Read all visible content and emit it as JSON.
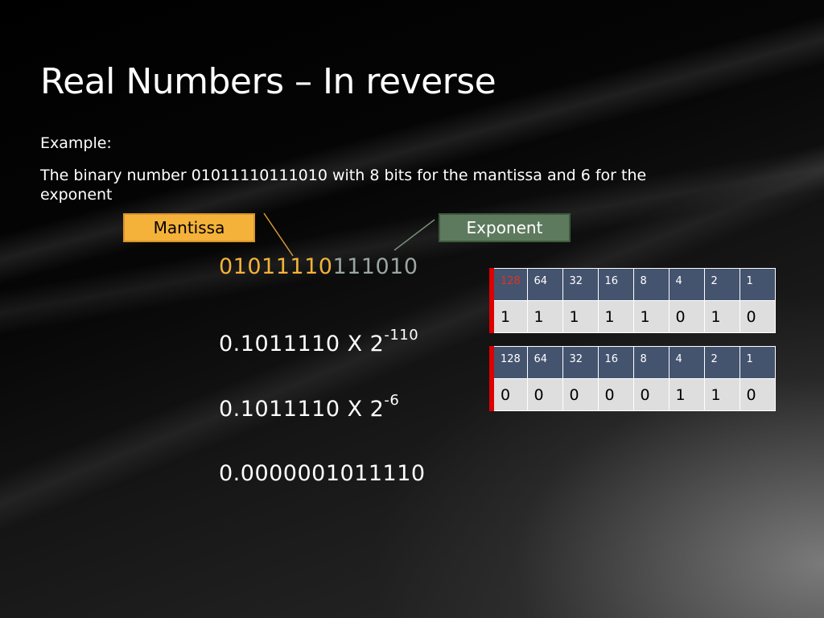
{
  "slide": {
    "title": "Real Numbers – In reverse",
    "example_label": "Example:",
    "description": "The binary number 01011110111010 with 8 bits for the mantissa and 6 for the exponent"
  },
  "labels": {
    "mantissa": "Mantissa",
    "exponent": "Exponent"
  },
  "binary": {
    "mantissa_bits": "01011110",
    "exponent_bits": "111010"
  },
  "steps": [
    {
      "base": "0.1011110 X 2",
      "power": "-110"
    },
    {
      "base": "0.1011110 X 2",
      "power": "-6"
    },
    {
      "base": "0.0000001011110",
      "power": ""
    }
  ],
  "tables": [
    {
      "headers": [
        "128",
        "64",
        "32",
        "16",
        "8",
        "4",
        "2",
        "1"
      ],
      "values": [
        "1",
        "1",
        "1",
        "1",
        "1",
        "0",
        "1",
        "0"
      ]
    },
    {
      "headers": [
        "128",
        "64",
        "32",
        "16",
        "8",
        "4",
        "2",
        "1"
      ],
      "values": [
        "0",
        "0",
        "0",
        "0",
        "0",
        "1",
        "1",
        "0"
      ]
    }
  ],
  "colors": {
    "mantissa": "#f4b23a",
    "exponent": "#5e7a5e",
    "table_header": "#44546f",
    "table_cell": "#dedede",
    "accent_bar": "#dd0000"
  }
}
